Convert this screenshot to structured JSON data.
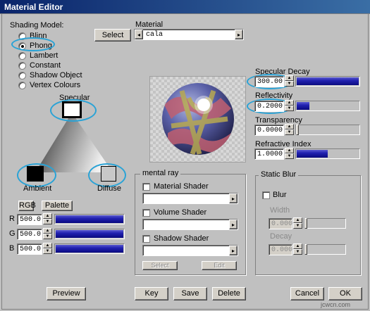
{
  "window": {
    "title": "Material Editor"
  },
  "shading": {
    "label": "Shading Model:",
    "options": [
      "Blinn",
      "Phong",
      "Lambert",
      "Constant",
      "Shadow Object",
      "Vertex Colours"
    ],
    "selected": "Phong"
  },
  "material": {
    "select_label": "Select",
    "label": "Material",
    "value": "cala",
    "left_arrow": "◂",
    "right_arrow": "▸"
  },
  "colors": {
    "specular_label": "Specular",
    "ambient_label": "Ambient",
    "diffuse_label": "Diffuse",
    "specular_color": "#ffffff",
    "ambient_color": "#000000",
    "diffuse_color": "#c8c8c8"
  },
  "rgb": {
    "rgb_button": "RGB",
    "palette_button": "Palette",
    "r_label": "R",
    "r_value": "500.0",
    "g_label": "G",
    "g_value": "500.0",
    "b_label": "B",
    "b_value": "500.0"
  },
  "params": {
    "specular_decay": {
      "label": "Specular Decay",
      "value": "300.00",
      "level": 1.0
    },
    "reflectivity": {
      "label": "Reflectivity",
      "value": "0.2000",
      "level": 0.2
    },
    "transparency": {
      "label": "Transparency",
      "value": "0.0000",
      "level": 0.0
    },
    "refractive_index": {
      "label": "Refractive Index",
      "value": "1.0000",
      "level": 0.5
    }
  },
  "mental_ray": {
    "title": "mental ray",
    "material_shader": "Material Shader",
    "volume_shader": "Volume Shader",
    "shadow_shader": "Shadow Shader",
    "select_label": "Select",
    "edit_label": "Edit"
  },
  "static_blur": {
    "title": "Static Blur",
    "blur_label": "Blur",
    "width_label": "Width",
    "width_value": "0.000",
    "decay_label": "Decay",
    "decay_value": "0.000"
  },
  "footer": {
    "preview": "Preview",
    "key": "Key",
    "save": "Save",
    "delete": "Delete",
    "cancel": "Cancel",
    "ok": "OK",
    "watermark": "jcwcn.com"
  },
  "accent": {
    "highlight": "#2aa3d6",
    "slider_blue": "#1a1aa0",
    "title_bar": "#0a246a"
  }
}
